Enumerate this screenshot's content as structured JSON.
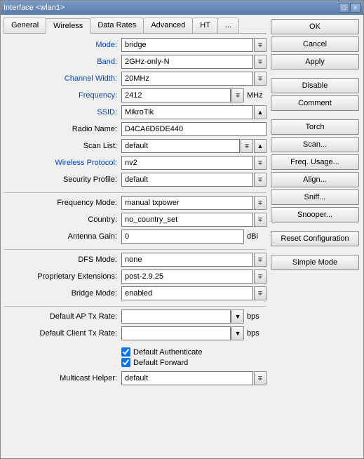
{
  "window": {
    "title": "Interface <wlan1>"
  },
  "tabs": {
    "general": "General",
    "wireless": "Wireless",
    "data_rates": "Data Rates",
    "advanced": "Advanced",
    "ht": "HT",
    "more": "..."
  },
  "fields": {
    "mode": {
      "label": "Mode:",
      "value": "bridge"
    },
    "band": {
      "label": "Band:",
      "value": "2GHz-only-N"
    },
    "channel_width": {
      "label": "Channel Width:",
      "value": "20MHz"
    },
    "frequency": {
      "label": "Frequency:",
      "value": "2412",
      "unit": "MHz"
    },
    "ssid": {
      "label": "SSID:",
      "value": "MikroTik"
    },
    "radio_name": {
      "label": "Radio Name:",
      "value": "D4CA6D6DE440"
    },
    "scan_list": {
      "label": "Scan List:",
      "value": "default"
    },
    "wireless_protocol": {
      "label": "Wireless Protocol:",
      "value": "nv2"
    },
    "security_profile": {
      "label": "Security Profile:",
      "value": "default"
    },
    "frequency_mode": {
      "label": "Frequency Mode:",
      "value": "manual txpower"
    },
    "country": {
      "label": "Country:",
      "value": "no_country_set"
    },
    "antenna_gain": {
      "label": "Antenna Gain:",
      "value": "0",
      "unit": "dBi"
    },
    "dfs_mode": {
      "label": "DFS Mode:",
      "value": "none"
    },
    "proprietary_ext": {
      "label": "Proprietary Extensions:",
      "value": "post-2.9.25"
    },
    "bridge_mode": {
      "label": "Bridge Mode:",
      "value": "enabled"
    },
    "default_ap_tx": {
      "label": "Default AP Tx Rate:",
      "value": "",
      "unit": "bps"
    },
    "default_client_tx": {
      "label": "Default Client Tx Rate:",
      "value": "",
      "unit": "bps"
    },
    "default_auth": {
      "label": "Default Authenticate"
    },
    "default_forward": {
      "label": "Default Forward"
    },
    "multicast_helper": {
      "label": "Multicast Helper:",
      "value": "default"
    }
  },
  "buttons": {
    "ok": "OK",
    "cancel": "Cancel",
    "apply": "Apply",
    "disable": "Disable",
    "comment": "Comment",
    "torch": "Torch",
    "scan": "Scan...",
    "freq_usage": "Freq. Usage...",
    "align": "Align...",
    "sniff": "Sniff...",
    "snooper": "Snooper...",
    "reset_config": "Reset Configuration",
    "simple_mode": "Simple Mode"
  }
}
